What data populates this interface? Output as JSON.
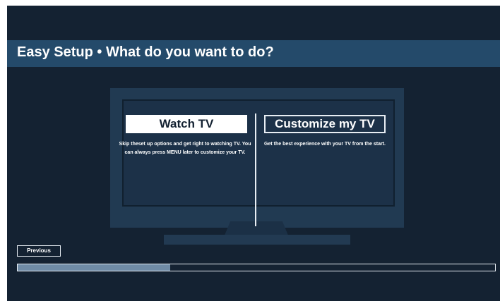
{
  "header": {
    "title": "Easy Setup • What do you want to do?"
  },
  "options": [
    {
      "label": "Watch TV",
      "description": "Skip theset up options and get right to watching TV. You can always press MENU later to customize your TV.",
      "selected": true
    },
    {
      "label": "Customize my TV",
      "description": "Get the best experience with your TV from the start.",
      "selected": false
    }
  ],
  "footer": {
    "previous_label": "Previous",
    "progress_fraction": 0.32
  },
  "colors": {
    "background": "#142232",
    "title_bar": "#244a6a",
    "tv_body": "#213a52",
    "progress_fill": "#6f8ba6"
  }
}
